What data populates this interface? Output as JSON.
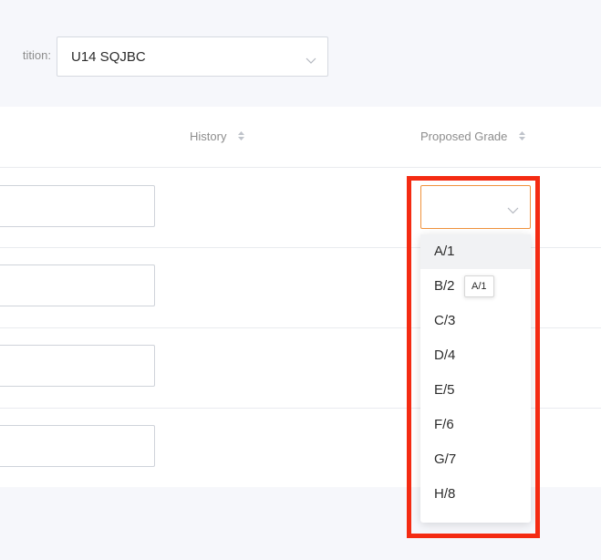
{
  "filter": {
    "label": "tition:",
    "value": "U14 SQJBC",
    "chevron_icon": "chevron-down-icon"
  },
  "table": {
    "columns": [
      {
        "label": "History",
        "sort_icon": "sort-icon"
      },
      {
        "label": "Proposed Grade",
        "sort_icon": "sort-icon"
      }
    ],
    "rows": [
      {
        "input_value": ""
      },
      {
        "input_value": ""
      },
      {
        "input_value": ""
      },
      {
        "input_value": ""
      }
    ]
  },
  "grade_dropdown": {
    "selected_value": "",
    "options": [
      "A/1",
      "B/2",
      "C/3",
      "D/4",
      "E/5",
      "F/6",
      "G/7",
      "H/8"
    ],
    "hovered_option": "A/1",
    "tooltip": "A/1"
  },
  "colors": {
    "highlight_border": "#f42b12",
    "focus_border": "#f0923c",
    "background": "#f6f7fb"
  }
}
